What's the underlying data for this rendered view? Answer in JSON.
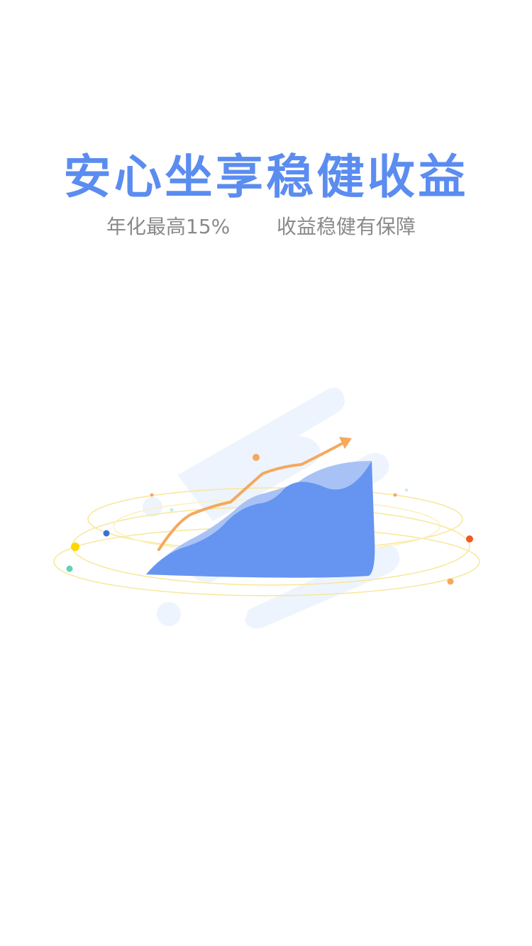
{
  "hero": {
    "title": "安心坐享稳健收益",
    "subtitle_left": "年化最高15%",
    "subtitle_right": "收益稳健有保障"
  },
  "illustration": {
    "icon": "rising-chart-illustration",
    "colors": {
      "area": "#5b8cf0",
      "area_light": "#a9c2f6",
      "trend_line": "#f5a85e",
      "ring": "#f7e79a",
      "backdrop": "#eef4fd"
    }
  }
}
